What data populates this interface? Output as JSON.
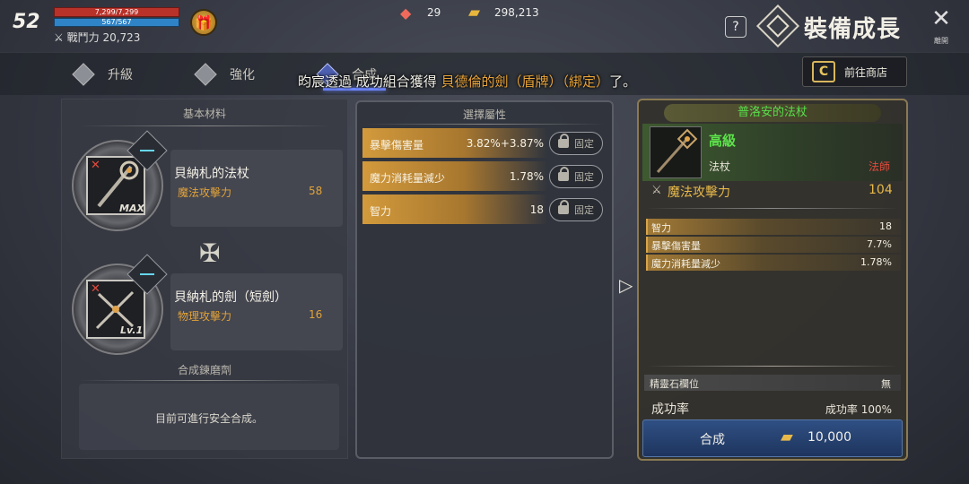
{
  "hud": {
    "level": "52",
    "hp": "7,299/7,299",
    "mp": "567/567",
    "power_label": "戰鬥力",
    "power_value": "20,723",
    "gem_count": "29",
    "gold_count": "298,213"
  },
  "header": {
    "title": "裝備成長",
    "help": "?",
    "close_label": "離開"
  },
  "tabs": [
    {
      "label": "升級"
    },
    {
      "label": "強化"
    },
    {
      "label": "合成"
    }
  ],
  "notification": {
    "prefix": "昀宸透過 成功組合獲得 ",
    "item": "貝德倫的劍（盾牌）（綁定）",
    "suffix": "了。"
  },
  "shop": {
    "label": "前往商店",
    "icon": "C"
  },
  "left": {
    "section_title": "基本材料",
    "materials": [
      {
        "name": "貝納札的法杖",
        "stat": "魔法攻擊力",
        "value": "58",
        "badge": "MAX"
      },
      {
        "name": "貝納札的劍（短劍）",
        "stat": "物理攻擊力",
        "value": "16",
        "badge": "Lv.1"
      }
    ],
    "stone_title": "合成鍊磨劑",
    "stone_text": "目前可進行安全合成。"
  },
  "middle": {
    "section_title": "選擇屬性",
    "attributes": [
      {
        "name": "暴擊傷害量",
        "value": "3.82%+3.87%",
        "lock": "固定"
      },
      {
        "name": "魔力消耗量減少",
        "value": "1.78%",
        "lock": "固定"
      },
      {
        "name": "智力",
        "value": "18",
        "lock": "固定"
      }
    ]
  },
  "result": {
    "title": "普洛安的法杖",
    "grade": "高級",
    "type": "法杖",
    "class": "法師",
    "main_stat": "魔法攻擊力",
    "main_value": "104",
    "attributes": [
      {
        "name": "智力",
        "value": "18"
      },
      {
        "name": "暴擊傷害量",
        "value": "7.7%"
      },
      {
        "name": "魔力消耗量減少",
        "value": "1.78%"
      }
    ],
    "socket_label": "精靈石欄位",
    "socket_value": "無",
    "rate_label": "成功率",
    "rate_value": "成功率 100%",
    "combine_label": "合成",
    "combine_cost": "10,000"
  },
  "colors": {
    "accent_gold": "#e2a338",
    "grade_green": "#5de34b",
    "class_red": "#e24a3c",
    "button_blue": "#2f4f83"
  }
}
